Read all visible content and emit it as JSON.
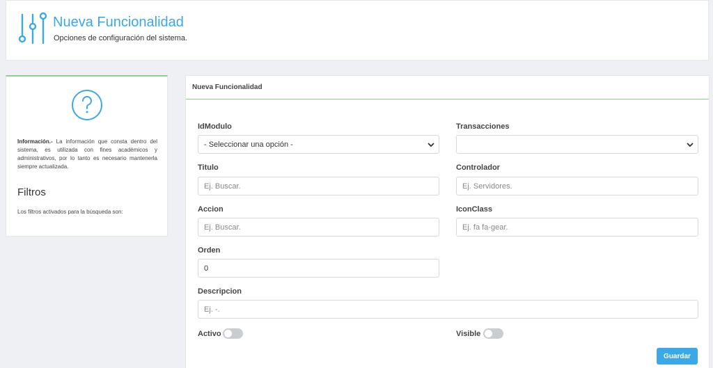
{
  "header": {
    "title": "Nueva Funcionalidad",
    "subtitle": "Opciones de configuración del sistema."
  },
  "sidebar": {
    "info_bold": "Información.-",
    "info_text": " La información que consta dentro del sistema, es utilizada con fines académicos y administrativos, por lo tanto es necesario mantenerla siempre actualizada.",
    "filters_title": "Filtros",
    "filters_text": "Los filtros activados para la búsqueda son:"
  },
  "panel": {
    "title": "Nueva Funcionalidad"
  },
  "form": {
    "idmodulo": {
      "label": "IdModulo",
      "value": "- Seleccionar una opción -"
    },
    "transacciones": {
      "label": "Transacciones",
      "value": ""
    },
    "titulo": {
      "label": "Titulo",
      "placeholder": "Ej. Buscar.",
      "value": ""
    },
    "controlador": {
      "label": "Controlador",
      "placeholder": "Ej. Servidores.",
      "value": ""
    },
    "accion": {
      "label": "Accion",
      "placeholder": "Ej. Buscar.",
      "value": ""
    },
    "iconclass": {
      "label": "IconClass",
      "placeholder": "Ej. fa fa-gear.",
      "value": ""
    },
    "orden": {
      "label": "Orden",
      "value": "0"
    },
    "descripcion": {
      "label": "Descripcion",
      "placeholder": "Ej. -.",
      "value": ""
    },
    "activo": {
      "label": "Activo",
      "checked": false
    },
    "visible": {
      "label": "Visible",
      "checked": false
    },
    "save_label": "Guardar"
  },
  "colors": {
    "accent": "#3ba8e8",
    "success_border": "#8bd08b",
    "toggle_off": "#c9ccd1"
  },
  "icons": {
    "header": "sliders-icon",
    "sidebar": "question-circle-icon",
    "select": "chevron-down-icon"
  }
}
